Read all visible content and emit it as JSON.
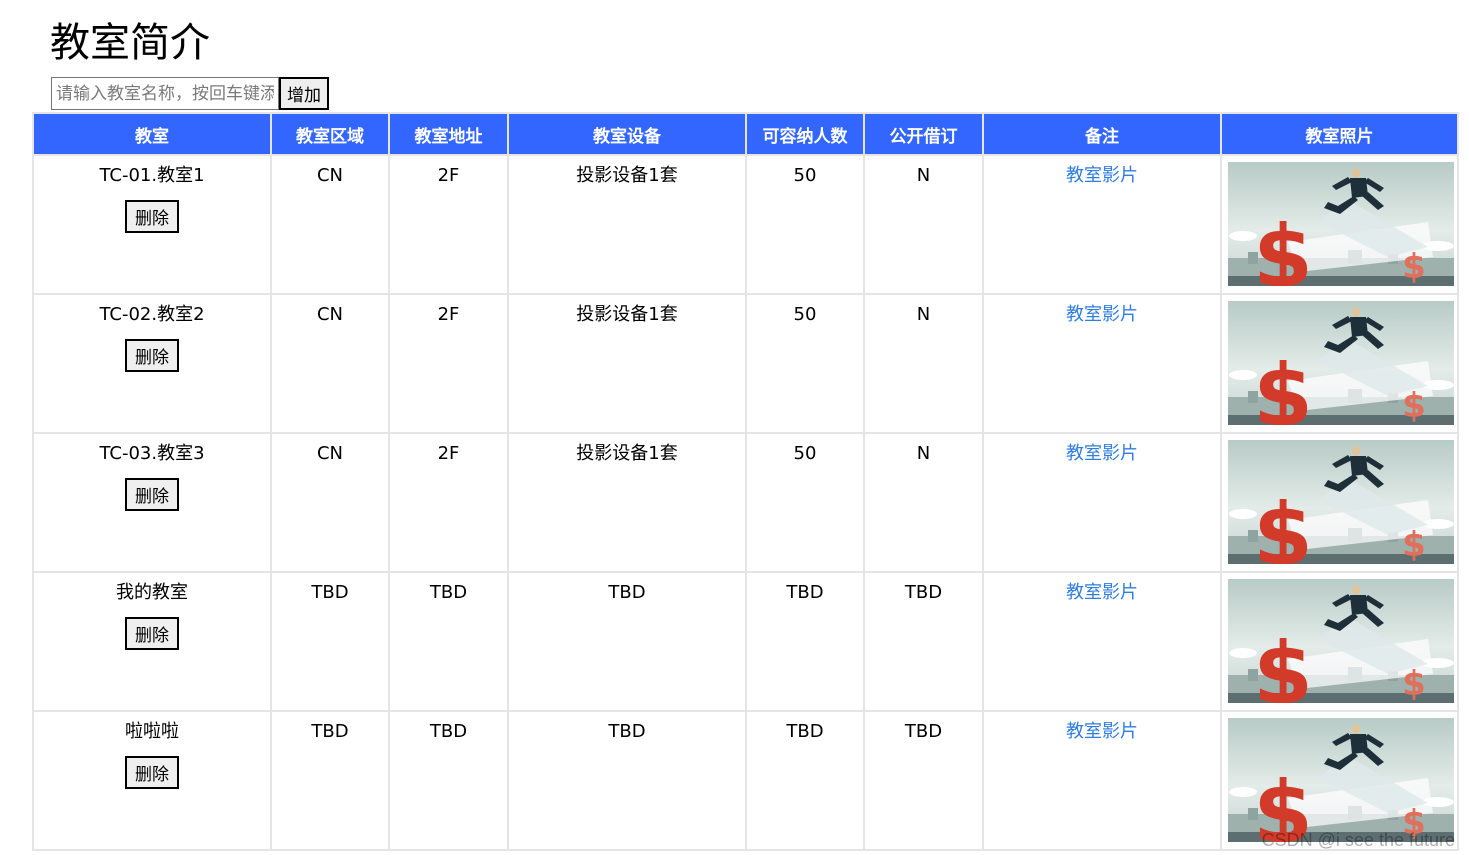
{
  "page": {
    "title": "教室简介"
  },
  "search": {
    "placeholder": "请输入教室名称，按回车键添加"
  },
  "toolbar": {
    "add_label": "增加"
  },
  "table": {
    "columns": [
      "教室",
      "教室区域",
      "教室地址",
      "教室设备",
      "可容纳人数",
      "公开借订",
      "备注",
      "教室照片"
    ],
    "delete_label": "删除",
    "rows": [
      {
        "name": "TC-01.教室1",
        "region": "CN",
        "address": "2F",
        "equipment": "投影设备1套",
        "capacity": "50",
        "public_booking": "N",
        "note": "教室影片"
      },
      {
        "name": "TC-02.教室2",
        "region": "CN",
        "address": "2F",
        "equipment": "投影设备1套",
        "capacity": "50",
        "public_booking": "N",
        "note": "教室影片"
      },
      {
        "name": "TC-03.教室3",
        "region": "CN",
        "address": "2F",
        "equipment": "投影设备1套",
        "capacity": "50",
        "public_booking": "N",
        "note": "教室影片"
      },
      {
        "name": "我的教室",
        "region": "TBD",
        "address": "TBD",
        "equipment": "TBD",
        "capacity": "TBD",
        "public_booking": "TBD",
        "note": "教室影片"
      },
      {
        "name": "啦啦啦",
        "region": "TBD",
        "address": "TBD",
        "equipment": "TBD",
        "capacity": "TBD",
        "public_booking": "TBD",
        "note": "教室影片"
      }
    ]
  },
  "watermark": "CSDN @i see the future",
  "colors": {
    "header_bg": "#3366ff",
    "header_text": "#ffffff",
    "link": "#2f7ddf",
    "border": "#e5e5e5"
  },
  "icons": {
    "photo": "businessman-leaping-over-dollar-sign-image"
  }
}
